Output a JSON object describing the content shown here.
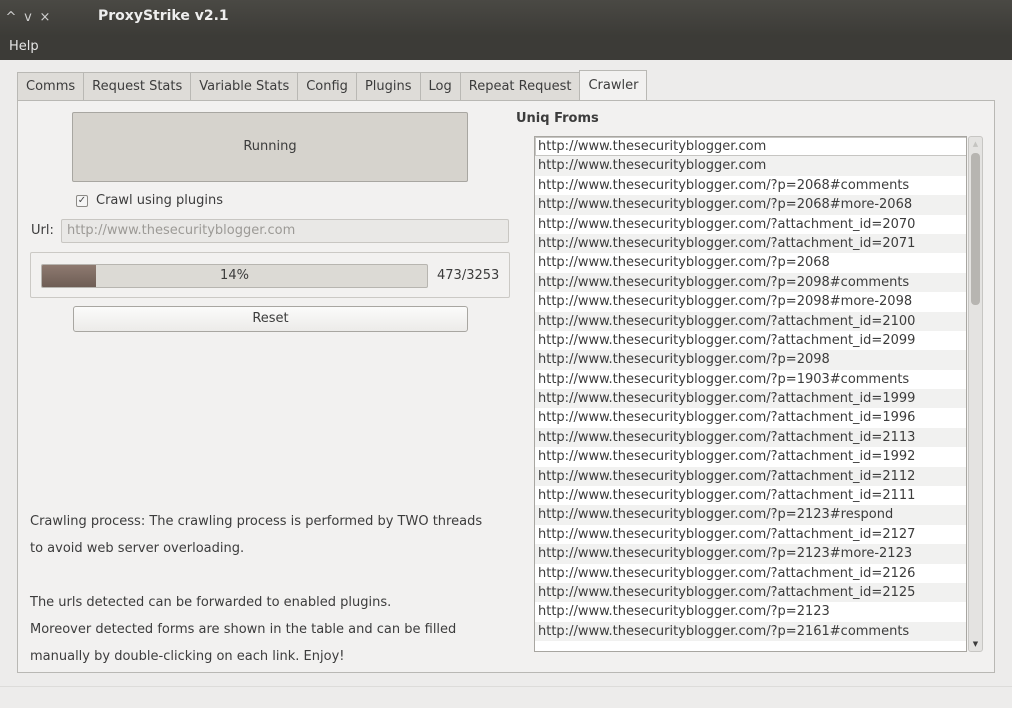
{
  "window": {
    "title": "ProxyStrike v2.1",
    "controls": [
      "^",
      "v",
      "×"
    ]
  },
  "menu": {
    "help": "Help"
  },
  "tabs": [
    {
      "label": "Comms",
      "active": false
    },
    {
      "label": "Request Stats",
      "active": false
    },
    {
      "label": "Variable Stats",
      "active": false
    },
    {
      "label": "Config",
      "active": false
    },
    {
      "label": "Plugins",
      "active": false
    },
    {
      "label": "Log",
      "active": false
    },
    {
      "label": "Repeat Request",
      "active": false
    },
    {
      "label": "Crawler",
      "active": true
    }
  ],
  "crawler": {
    "running_label": "Running",
    "crawl_using_plugins": {
      "label": "Crawl using plugins",
      "checked": true
    },
    "url_label": "Url:",
    "url_value": "http://www.thesecurityblogger.com",
    "progress": {
      "percent": 14,
      "text": "14%",
      "count": "473/3253"
    },
    "reset_label": "Reset",
    "info": [
      "Crawling process: The crawling process is performed by TWO threads",
      "to avoid web server overloading.",
      "The urls detected can be forwarded to enabled plugins.",
      "Moreover detected forms are shown in the table and can be filled",
      "manually by double-clicking on each link. Enjoy!"
    ]
  },
  "uniq_froms": {
    "title": "Uniq Froms",
    "items": [
      "http://www.thesecurityblogger.com",
      "http://www.thesecurityblogger.com",
      "http://www.thesecurityblogger.com/?p=2068#comments",
      "http://www.thesecurityblogger.com/?p=2068#more-2068",
      "http://www.thesecurityblogger.com/?attachment_id=2070",
      "http://www.thesecurityblogger.com/?attachment_id=2071",
      "http://www.thesecurityblogger.com/?p=2068",
      "http://www.thesecurityblogger.com/?p=2098#comments",
      "http://www.thesecurityblogger.com/?p=2098#more-2098",
      "http://www.thesecurityblogger.com/?attachment_id=2100",
      "http://www.thesecurityblogger.com/?attachment_id=2099",
      "http://www.thesecurityblogger.com/?p=2098",
      "http://www.thesecurityblogger.com/?p=1903#comments",
      "http://www.thesecurityblogger.com/?attachment_id=1999",
      "http://www.thesecurityblogger.com/?attachment_id=1996",
      "http://www.thesecurityblogger.com/?attachment_id=2113",
      "http://www.thesecurityblogger.com/?attachment_id=1992",
      "http://www.thesecurityblogger.com/?attachment_id=2112",
      "http://www.thesecurityblogger.com/?attachment_id=2111",
      "http://www.thesecurityblogger.com/?p=2123#respond",
      "http://www.thesecurityblogger.com/?attachment_id=2127",
      "http://www.thesecurityblogger.com/?p=2123#more-2123",
      "http://www.thesecurityblogger.com/?attachment_id=2126",
      "http://www.thesecurityblogger.com/?attachment_id=2125",
      "http://www.thesecurityblogger.com/?p=2123",
      "http://www.thesecurityblogger.com/?p=2161#comments"
    ]
  }
}
